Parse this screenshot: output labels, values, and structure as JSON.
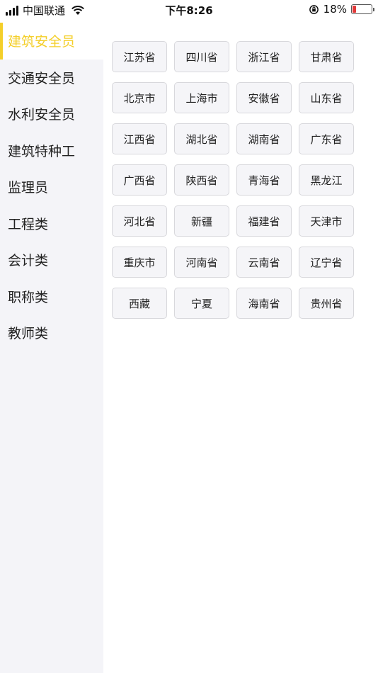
{
  "status_bar": {
    "carrier": "中国联通",
    "time": "下午8:26",
    "battery_percent": "18%",
    "battery_level": 0.18
  },
  "sidebar": {
    "items": [
      {
        "label": "建筑安全员",
        "active": true
      },
      {
        "label": "交通安全员",
        "active": false
      },
      {
        "label": "水利安全员",
        "active": false
      },
      {
        "label": "建筑特种工",
        "active": false
      },
      {
        "label": "监理员",
        "active": false
      },
      {
        "label": "工程类",
        "active": false
      },
      {
        "label": "会计类",
        "active": false
      },
      {
        "label": "职称类",
        "active": false
      },
      {
        "label": "教师类",
        "active": false
      }
    ],
    "accent_color": "#f4cf2a"
  },
  "provinces": [
    "江苏省",
    "四川省",
    "浙江省",
    "甘肃省",
    "北京市",
    "上海市",
    "安徽省",
    "山东省",
    "江西省",
    "湖北省",
    "湖南省",
    "广东省",
    "广西省",
    "陕西省",
    "青海省",
    "黑龙江",
    "河北省",
    "新疆",
    "福建省",
    "天津市",
    "重庆市",
    "河南省",
    "云南省",
    "辽宁省",
    "西藏",
    "宁夏",
    "海南省",
    "贵州省"
  ]
}
